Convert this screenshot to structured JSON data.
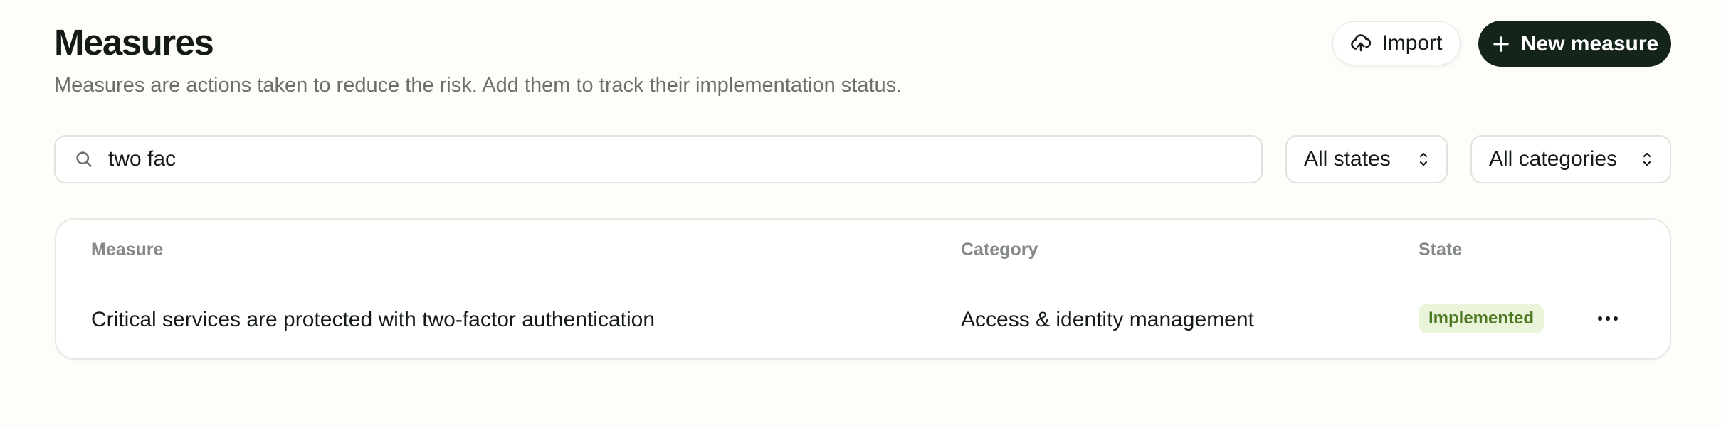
{
  "header": {
    "title": "Measures",
    "subtitle": "Measures are actions taken to reduce the risk. Add them to track their implementation status.",
    "import_label": "Import",
    "new_label": "New measure"
  },
  "filters": {
    "search_value": "two fac",
    "state_select": "All states",
    "category_select": "All categories"
  },
  "table": {
    "columns": {
      "measure": "Measure",
      "category": "Category",
      "state": "State"
    },
    "rows": [
      {
        "measure": "Critical services are protected with two-factor authentication",
        "category": "Access & identity management",
        "state": "Implemented"
      }
    ]
  },
  "icons": {
    "import": "cloud-upload-icon",
    "new": "plus-icon",
    "search": "search-icon",
    "select": "chevron-up-down-icon",
    "more": "more-horizontal-icon"
  },
  "colors": {
    "primary_button": "#15241a",
    "badge_bg": "#eaf4da",
    "badge_text": "#4f7a22",
    "background": "#fdfdfa"
  }
}
